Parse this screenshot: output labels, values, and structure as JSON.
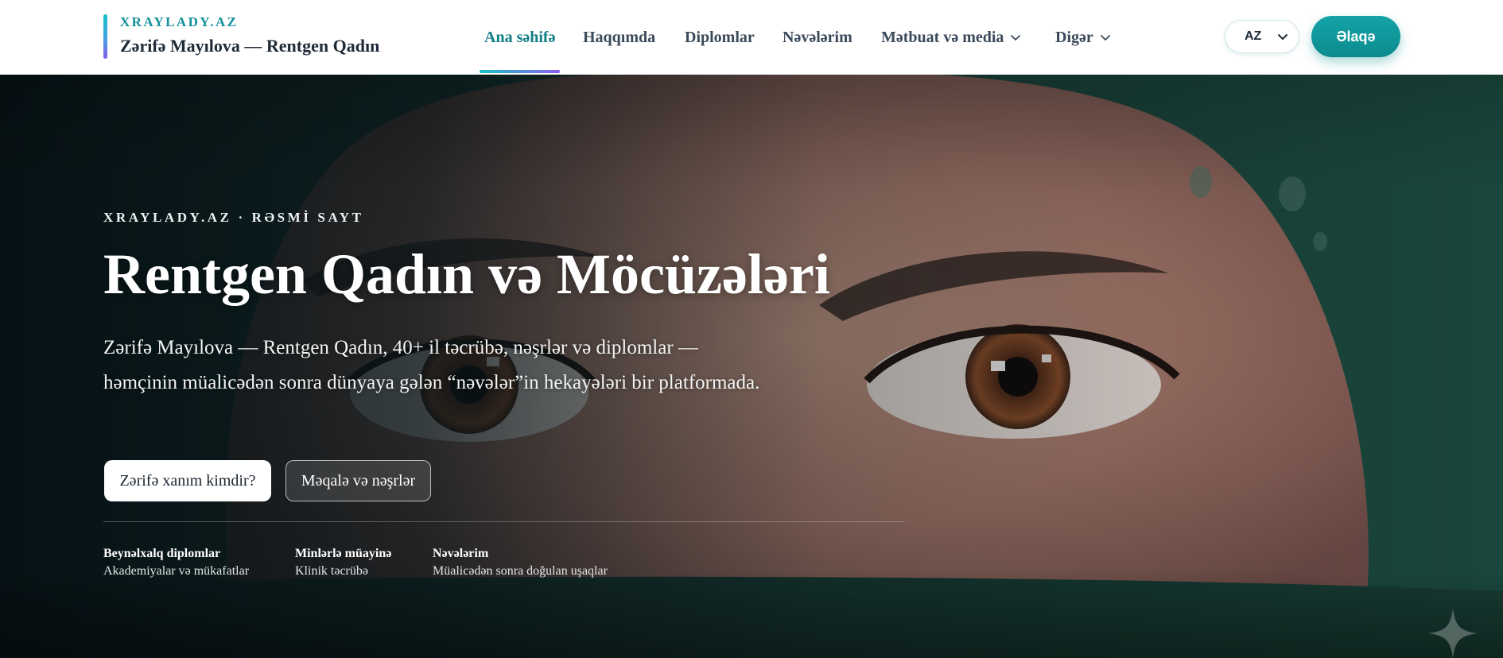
{
  "brand": {
    "domain": "XRAYLADY.AZ",
    "name": "Zərifə Mayılova — Rentgen Qadın"
  },
  "nav": {
    "items": [
      {
        "label": "Ana səhifə",
        "active": true,
        "has_dropdown": false
      },
      {
        "label": "Haqqımda",
        "active": false,
        "has_dropdown": false
      },
      {
        "label": "Diplomlar",
        "active": false,
        "has_dropdown": false
      },
      {
        "label": "Nəvələrim",
        "active": false,
        "has_dropdown": false
      },
      {
        "label": "Mətbuat və media",
        "active": false,
        "has_dropdown": true
      },
      {
        "label": "Digər",
        "active": false,
        "has_dropdown": true
      }
    ]
  },
  "language": {
    "selected": "AZ"
  },
  "contact_button": {
    "label": "Əlaqə"
  },
  "hero": {
    "kicker": "XRAYLADY.AZ · RƏSMİ SAYT",
    "title": "Rentgen Qadın və Möcüzələri",
    "subtitle": "Zərifə Mayılova — Rentgen Qadın, 40+ il təcrübə, nəşrlər və diplomlar — həmçinin müalicədən sonra dünyaya gələn “nəvələr”in hekayələri bir platformada.",
    "primary_button": "Zərifə xanım kimdir?",
    "secondary_button": "Məqalə və nəşrlər",
    "stats": [
      {
        "title": "Beynəlxalq diplomlar",
        "desc": "Akademiyalar və mükafatlar"
      },
      {
        "title": "Minlərlə müayinə",
        "desc": "Klinik təcrübə"
      },
      {
        "title": "Nəvələrim",
        "desc": "Müalicədən sonra doğulan uşaqlar"
      }
    ]
  },
  "colors": {
    "accent": "#0c8b8f",
    "brand_teal": "#12909a",
    "nav_active": "#137f86",
    "hijab_green": "#1d4b3f"
  },
  "icons": {
    "dropdown": "chevron-down-icon",
    "decor": "sparkle-icon"
  }
}
